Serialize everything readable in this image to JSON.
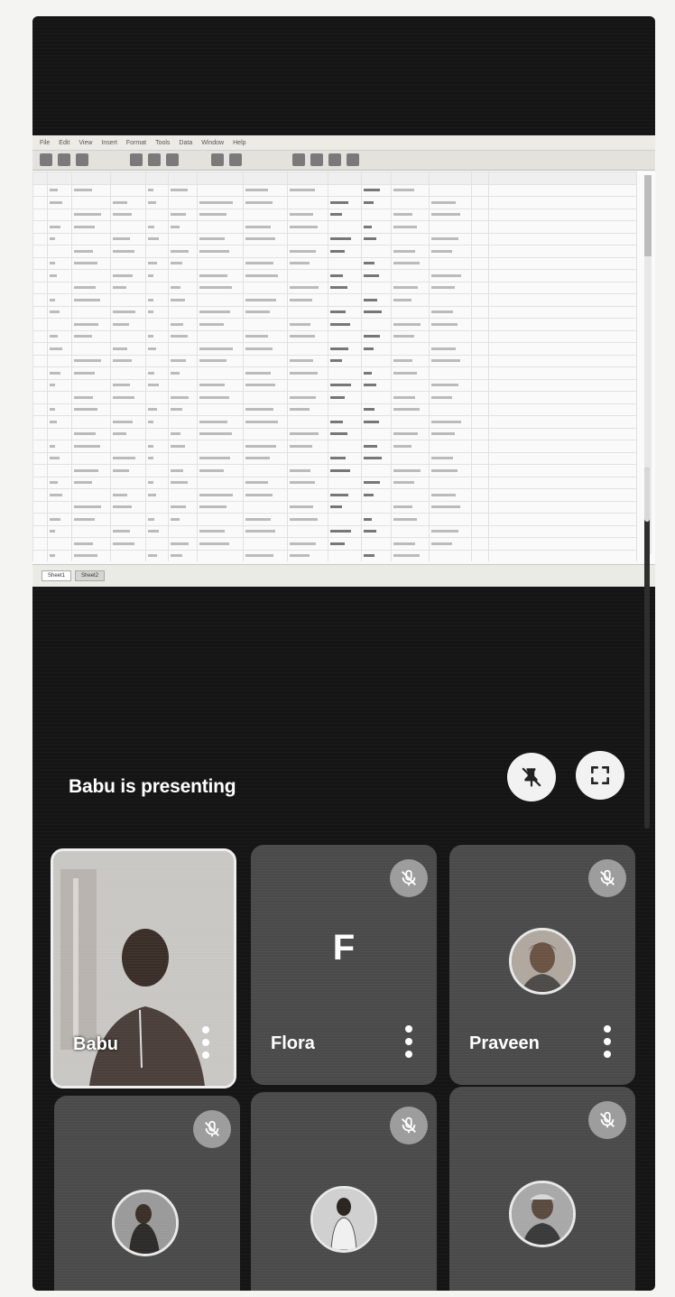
{
  "app": {
    "name": ""
  },
  "shared_screen": {
    "menu": [
      "File",
      "Edit",
      "View",
      "Insert",
      "Format",
      "Tools",
      "Data",
      "Window",
      "Help"
    ],
    "sheet_tabs": [
      "Sheet1",
      "Sheet2"
    ]
  },
  "presentation": {
    "label": "Babu is presenting",
    "pin_icon": "unpin-icon",
    "fullscreen_icon": "fullscreen-icon"
  },
  "participants": [
    {
      "name": "Babu",
      "type": "video",
      "muted": false
    },
    {
      "name": "Flora",
      "type": "initial",
      "initial": "F",
      "muted": true
    },
    {
      "name": "Praveen",
      "type": "avatar",
      "muted": true
    },
    {
      "name": "",
      "type": "avatar",
      "muted": true
    },
    {
      "name": "",
      "type": "avatar",
      "muted": true
    },
    {
      "name": "",
      "type": "avatar",
      "muted": true
    }
  ],
  "colors": {
    "background": "#151515",
    "tile": "#4a4a4a",
    "muted_badge": "#9c9c9c"
  }
}
